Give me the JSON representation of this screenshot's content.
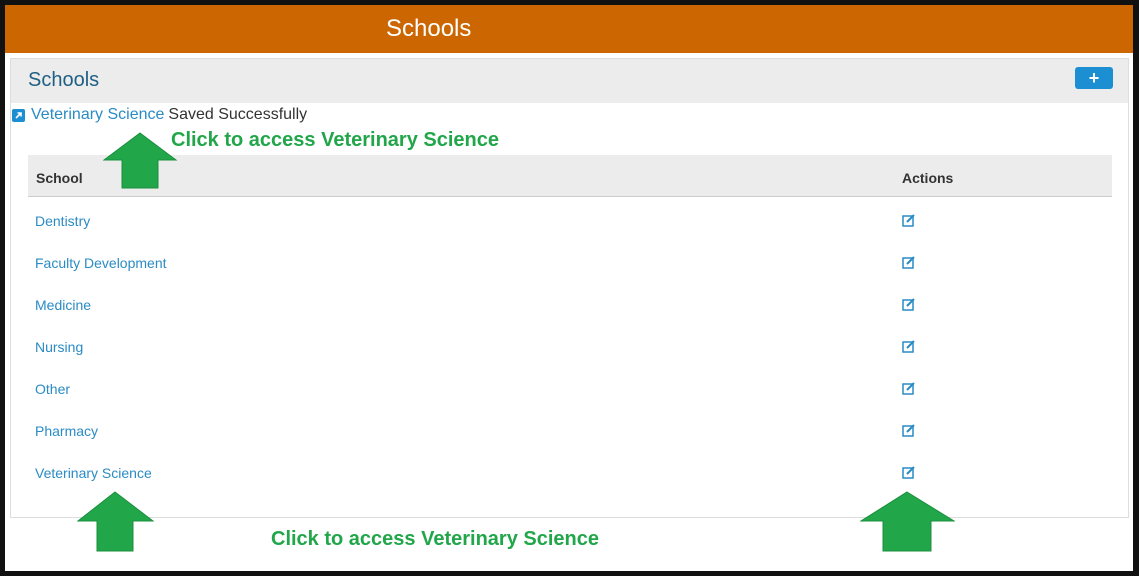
{
  "app": {
    "title": "Schools"
  },
  "panel": {
    "title": "Schools",
    "add_label": "+"
  },
  "notice": {
    "link": "Veterinary Science",
    "message": "Saved Successfully"
  },
  "table": {
    "headers": {
      "school": "School",
      "actions": "Actions"
    },
    "rows": [
      {
        "name": "Dentistry"
      },
      {
        "name": "Faculty Development"
      },
      {
        "name": "Medicine"
      },
      {
        "name": "Nursing"
      },
      {
        "name": "Other"
      },
      {
        "name": "Pharmacy"
      },
      {
        "name": "Veterinary Science"
      }
    ]
  },
  "annotations": {
    "top_callout": "Click to access Veterinary Science",
    "bottom_callout": "Click to access Veterinary Science"
  },
  "colors": {
    "brand": "#cc6600",
    "link": "#2a8bc5",
    "button": "#1b8fd1",
    "annotation": "#22a64a"
  },
  "icons": {
    "edit": "edit-icon",
    "external_link": "external-link-icon",
    "annotation_arrow": "arrow-up-icon"
  }
}
